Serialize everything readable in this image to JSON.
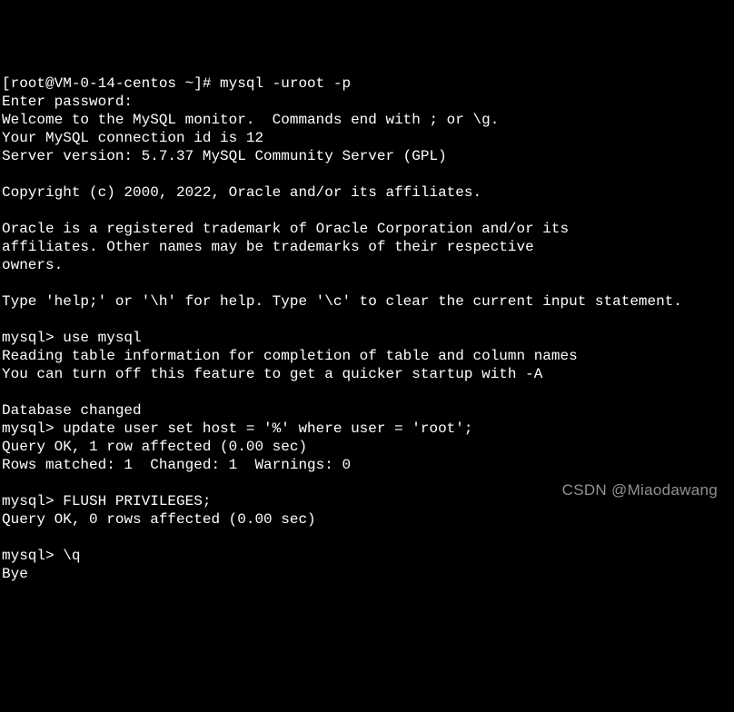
{
  "terminal": {
    "lines": [
      "[root@VM-0-14-centos ~]# mysql -uroot -p",
      "Enter password:",
      "Welcome to the MySQL monitor.  Commands end with ; or \\g.",
      "Your MySQL connection id is 12",
      "Server version: 5.7.37 MySQL Community Server (GPL)",
      "",
      "Copyright (c) 2000, 2022, Oracle and/or its affiliates.",
      "",
      "Oracle is a registered trademark of Oracle Corporation and/or its",
      "affiliates. Other names may be trademarks of their respective",
      "owners.",
      "",
      "Type 'help;' or '\\h' for help. Type '\\c' to clear the current input statement.",
      "",
      "mysql> use mysql",
      "Reading table information for completion of table and column names",
      "You can turn off this feature to get a quicker startup with -A",
      "",
      "Database changed",
      "mysql> update user set host = '%' where user = 'root';",
      "Query OK, 1 row affected (0.00 sec)",
      "Rows matched: 1  Changed: 1  Warnings: 0",
      "",
      "mysql> FLUSH PRIVILEGES;",
      "Query OK, 0 rows affected (0.00 sec)",
      "",
      "mysql> \\q",
      "Bye"
    ]
  },
  "watermark": "CSDN @Miaodawang"
}
